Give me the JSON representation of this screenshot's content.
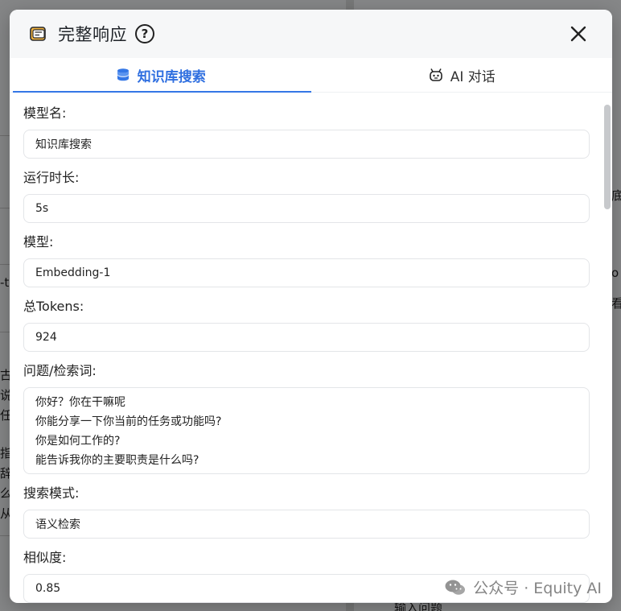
{
  "modal": {
    "title": "完整响应",
    "help_symbol": "?",
    "close_symbol": "✕"
  },
  "tabs": [
    {
      "label": "知识库搜索",
      "icon": "database-icon",
      "active": true
    },
    {
      "label": "AI 对话",
      "icon": "robot-icon",
      "active": false
    }
  ],
  "fields": {
    "model_name": {
      "label": "模型名:",
      "value": "知识库搜索"
    },
    "run_time": {
      "label": "运行时长:",
      "value": "5s"
    },
    "model": {
      "label": "模型:",
      "value": "Embedding-1"
    },
    "total_tokens": {
      "label": "总Tokens:",
      "value": "924"
    },
    "query": {
      "label": "问题/检索词:",
      "lines": [
        "你好？你在干嘛呢",
        "你能分享一下你当前的任务或功能吗?",
        "你是如何工作的?",
        "能告诉我你的主要职责是什么吗?"
      ]
    },
    "search_mode": {
      "label": "搜索模式:",
      "value": "语义检索"
    },
    "similarity": {
      "label": "相似度:",
      "value": "0.85"
    }
  },
  "background": {
    "fragments": [
      "底",
      "o",
      "看",
      "-t",
      "古",
      "说",
      "任",
      "指",
      "辞",
      "么",
      "从",
      "输入问题"
    ]
  },
  "watermark": {
    "text": "公众号 · Equity AI"
  },
  "colors": {
    "accent": "#3477e6",
    "header_bg": "#f6f7f8",
    "border": "#e3e5e8"
  }
}
